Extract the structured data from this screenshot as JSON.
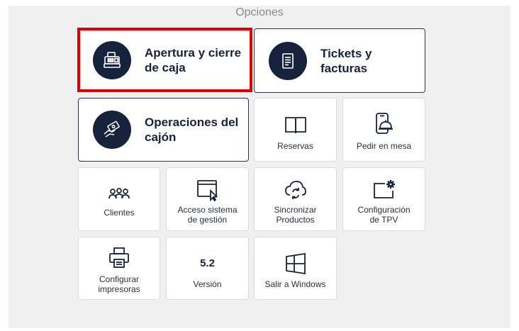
{
  "window": {
    "title": "Opciones"
  },
  "tiles": {
    "cash": {
      "label": "Apertura y cierre de caja"
    },
    "tickets": {
      "label": "Tickets y facturas"
    },
    "drawer": {
      "label": "Operaciones del cajón"
    },
    "reservas": {
      "label": "Reservas"
    },
    "pedir": {
      "label": "Pedir en mesa"
    },
    "clientes": {
      "label": "Clientes"
    },
    "acceso": {
      "label_line1": "Acceso sistema",
      "label_line2": "de gestión"
    },
    "sincronizar": {
      "label_line1": "Sincronizar",
      "label_line2": "Productos"
    },
    "config_tpv": {
      "label_line1": "Configuración",
      "label_line2": "de TPV"
    },
    "impresoras": {
      "label_line1": "Configurar",
      "label_line2": "impresoras"
    },
    "version": {
      "number": "5.2",
      "label": "Versión"
    },
    "windows": {
      "label": "Salir a Windows"
    }
  },
  "colors": {
    "navy": "#17233c",
    "highlight": "#e00000",
    "panel": "#f0f0f0"
  }
}
